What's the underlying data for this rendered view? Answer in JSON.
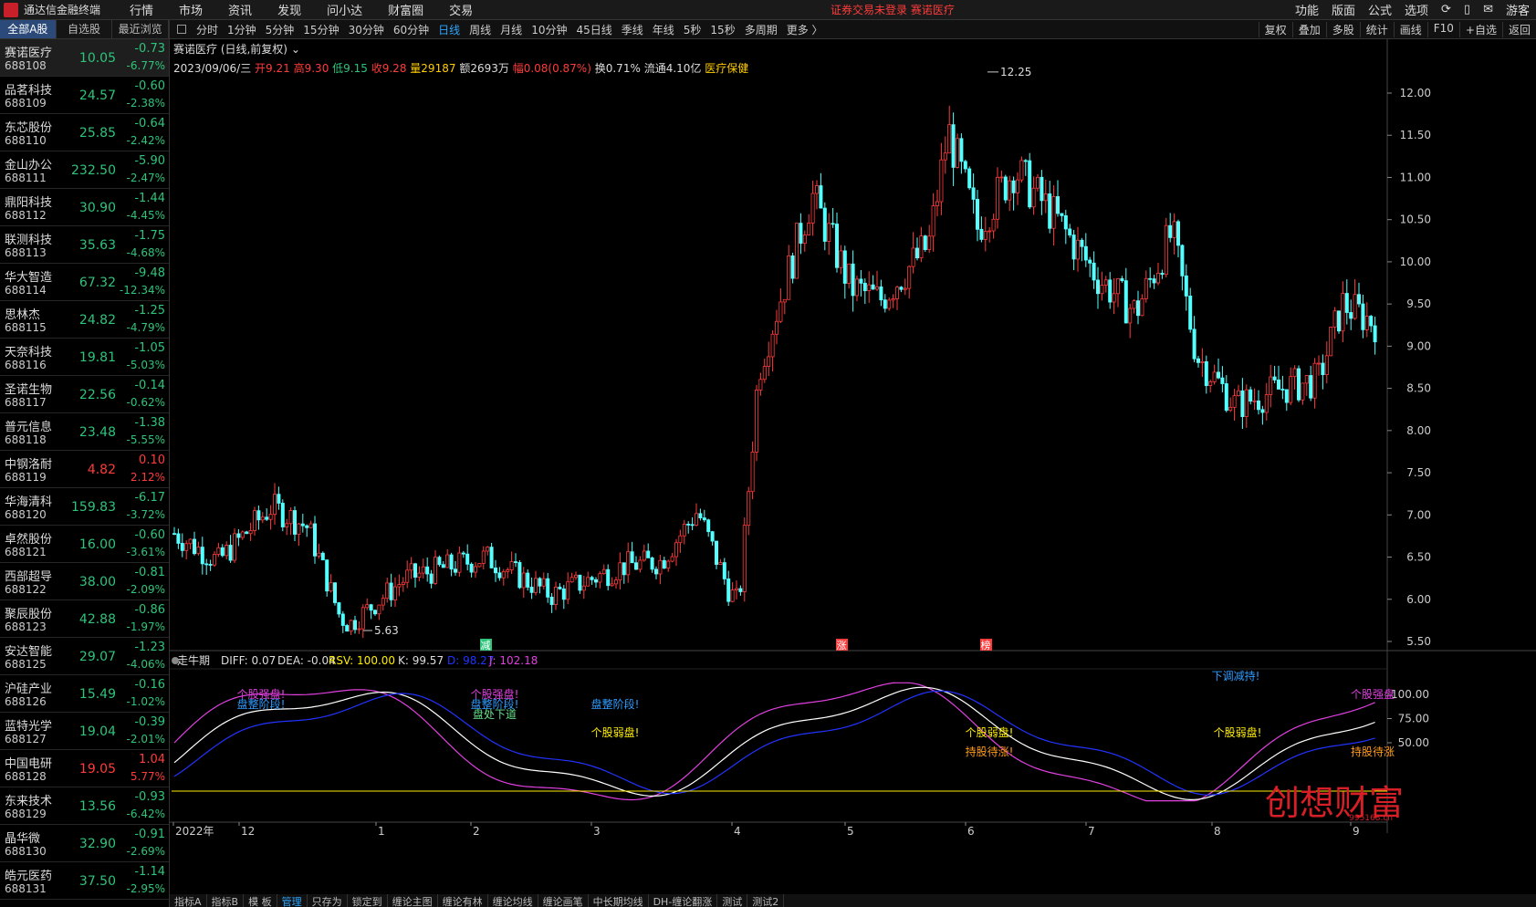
{
  "app": {
    "title": "通达信金融终端",
    "menus": [
      "行情",
      "市场",
      "资讯",
      "发现",
      "问小达",
      "财富圈",
      "交易"
    ],
    "notice": "证券交易未登录  赛诺医疗",
    "right_menus": [
      "功能",
      "版面",
      "公式",
      "选项"
    ],
    "user": "游客"
  },
  "sidebar": {
    "tabs": [
      "全部A股",
      "自选股",
      "最近浏览"
    ],
    "stocks": [
      {
        "name": "赛诺医疗",
        "code": "688108",
        "price": "10.05",
        "change": "-0.73",
        "pct": "-6.77%",
        "dir": "dn"
      },
      {
        "name": "品茗科技",
        "code": "688109",
        "price": "24.57",
        "change": "-0.60",
        "pct": "-2.38%",
        "dir": "dn"
      },
      {
        "name": "东芯股份",
        "code": "688110",
        "price": "25.85",
        "change": "-0.64",
        "pct": "-2.42%",
        "dir": "dn"
      },
      {
        "name": "金山办公",
        "code": "688111",
        "price": "232.50",
        "change": "-5.90",
        "pct": "-2.47%",
        "dir": "dn"
      },
      {
        "name": "鼎阳科技",
        "code": "688112",
        "price": "30.90",
        "change": "-1.44",
        "pct": "-4.45%",
        "dir": "dn"
      },
      {
        "name": "联测科技",
        "code": "688113",
        "price": "35.63",
        "change": "-1.75",
        "pct": "-4.68%",
        "dir": "dn"
      },
      {
        "name": "华大智造",
        "code": "688114",
        "price": "67.32",
        "change": "-9.48",
        "pct": "-12.34%",
        "dir": "dn"
      },
      {
        "name": "思林杰",
        "code": "688115",
        "price": "24.82",
        "change": "-1.25",
        "pct": "-4.79%",
        "dir": "dn"
      },
      {
        "name": "天奈科技",
        "code": "688116",
        "price": "19.81",
        "change": "-1.05",
        "pct": "-5.03%",
        "dir": "dn"
      },
      {
        "name": "圣诺生物",
        "code": "688117",
        "price": "22.56",
        "change": "-0.14",
        "pct": "-0.62%",
        "dir": "dn"
      },
      {
        "name": "普元信息",
        "code": "688118",
        "price": "23.48",
        "change": "-1.38",
        "pct": "-5.55%",
        "dir": "dn"
      },
      {
        "name": "中钢洛耐",
        "code": "688119",
        "price": "4.82",
        "change": "0.10",
        "pct": "2.12%",
        "dir": "up"
      },
      {
        "name": "华海清科",
        "code": "688120",
        "price": "159.83",
        "change": "-6.17",
        "pct": "-3.72%",
        "dir": "dn"
      },
      {
        "name": "卓然股份",
        "code": "688121",
        "price": "16.00",
        "change": "-0.60",
        "pct": "-3.61%",
        "dir": "dn"
      },
      {
        "name": "西部超导",
        "code": "688122",
        "price": "38.00",
        "change": "-0.81",
        "pct": "-2.09%",
        "dir": "dn"
      },
      {
        "name": "聚辰股份",
        "code": "688123",
        "price": "42.88",
        "change": "-0.86",
        "pct": "-1.97%",
        "dir": "dn"
      },
      {
        "name": "安达智能",
        "code": "688125",
        "price": "29.07",
        "change": "-1.23",
        "pct": "-4.06%",
        "dir": "dn"
      },
      {
        "name": "沪硅产业",
        "code": "688126",
        "price": "15.49",
        "change": "-0.16",
        "pct": "-1.02%",
        "dir": "dn"
      },
      {
        "name": "蓝特光学",
        "code": "688127",
        "price": "19.04",
        "change": "-0.39",
        "pct": "-2.01%",
        "dir": "dn"
      },
      {
        "name": "中国电研",
        "code": "688128",
        "price": "19.05",
        "change": "1.04",
        "pct": "5.77%",
        "dir": "up"
      },
      {
        "name": "东来技术",
        "code": "688129",
        "price": "13.56",
        "change": "-0.93",
        "pct": "-6.42%",
        "dir": "dn"
      },
      {
        "name": "晶华微",
        "code": "688130",
        "price": "32.90",
        "change": "-0.91",
        "pct": "-2.69%",
        "dir": "dn"
      },
      {
        "name": "皓元医药",
        "code": "688131",
        "price": "37.50",
        "change": "-1.14",
        "pct": "-2.95%",
        "dir": "dn"
      }
    ]
  },
  "periodbar": {
    "items": [
      "分时",
      "1分钟",
      "5分钟",
      "15分钟",
      "30分钟",
      "60分钟",
      "日线",
      "周线",
      "月线",
      "10分钟",
      "45日线",
      "季线",
      "年线",
      "5秒",
      "15秒",
      "多周期",
      "更多 〉"
    ],
    "active": "日线",
    "tools": [
      "复权",
      "叠加",
      "多股",
      "统计",
      "画线",
      "F10",
      "+自选",
      "返回"
    ]
  },
  "chartinfo": {
    "title": "赛诺医疗 (日线,前复权)",
    "date": "2023/09/06/三",
    "open": "开9.21",
    "high": "高9.30",
    "low": "低9.15",
    "close": "收9.28",
    "vol": "量29187",
    "amount": "额2693万",
    "amplitude": "幅0.08(0.87%)",
    "turnover": "换0.71%",
    "float": "流通4.10亿",
    "sector": "医疗保健"
  },
  "indicator": {
    "name": "走牛期",
    "diff": "DIFF: 0.07",
    "dea": "DEA: -0.04",
    "rsv": "RSV: 100.00",
    "k": "K: 99.57",
    "d": "D: 98.27",
    "j": "J: 102.18",
    "axis": [
      "100.00",
      "75.00",
      "50.00"
    ],
    "annotations": [
      {
        "text": "个股强盘!",
        "color": "#e040e0"
      },
      {
        "text": "盘整阶段!",
        "color": "#2e9bff"
      },
      {
        "text": "个股强盘!",
        "color": "#e040e0"
      },
      {
        "text": "盘整阶段!",
        "color": "#2e9bff"
      },
      {
        "text": "盘处下道",
        "color": "#66e08a"
      },
      {
        "text": "盘整阶段!",
        "color": "#2e9bff"
      },
      {
        "text": "个股弱盘!",
        "color": "#ffee00"
      },
      {
        "text": "个股弱盘!",
        "color": "#ffee00"
      },
      {
        "text": "持股待涨!",
        "color": "#ff9a1a"
      },
      {
        "text": "个股弱盘!",
        "color": "#ffee00"
      },
      {
        "text": "下调减持!",
        "color": "#2e9bff"
      },
      {
        "text": "个股强盘",
        "color": "#e040e0"
      },
      {
        "text": "持股待涨",
        "color": "#ff9a1a"
      }
    ]
  },
  "price_axis": [
    "12.00",
    "11.50",
    "11.00",
    "10.50",
    "10.00",
    "9.50",
    "9.00",
    "8.50",
    "8.00",
    "7.50",
    "7.00",
    "6.50",
    "6.00",
    "5.50"
  ],
  "extremes": {
    "high": "12.25",
    "low": "5.63"
  },
  "signals": [
    "减",
    "涨",
    "榜"
  ],
  "time_axis": [
    "2022年",
    "12",
    "1",
    "2",
    "3",
    "4",
    "5",
    "6",
    "7",
    "8",
    "9"
  ],
  "bottom_tabs": [
    "指标A",
    "指标B",
    "模 板",
    "管理",
    "只存为",
    "锁定到",
    "缠论主图",
    "缠论有林",
    "缠论均线",
    "缠论画笔",
    "中长期均线",
    "DH-缠论翻涨",
    "测试",
    "测试2"
  ],
  "watermark": {
    "text": "创想财富",
    "url": "995168.cn"
  },
  "colors": {
    "up": "#ff3b3b",
    "down": "#2ec47a",
    "candle_down": "#54ffff",
    "candle_up": "#ff3b3b",
    "k": "#ffffff",
    "d": "#2233ff",
    "j": "#e040e0",
    "rsv": "#ffee00"
  }
}
